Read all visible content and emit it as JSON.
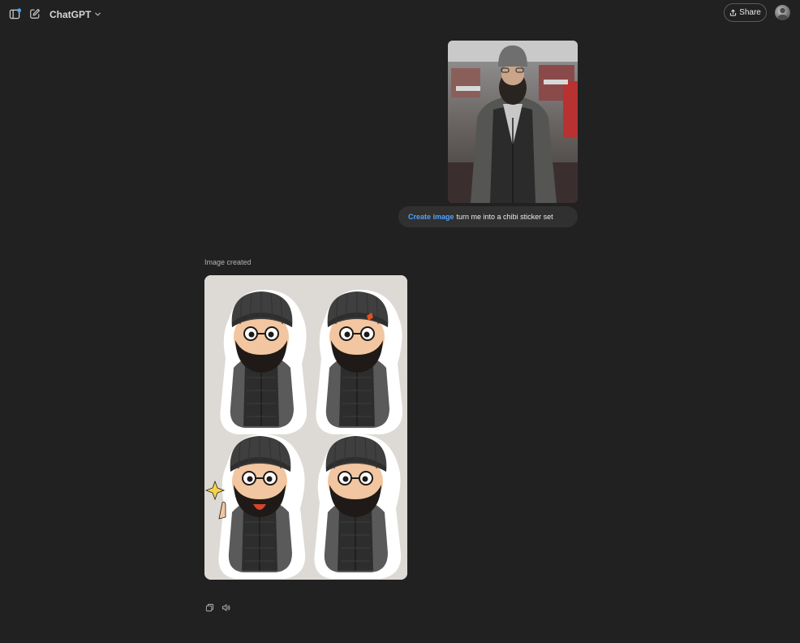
{
  "header": {
    "model_name": "ChatGPT",
    "share_label": "Share",
    "icons": [
      "sidebar-toggle-icon",
      "new-chat-icon",
      "chevron-down-icon",
      "share-upload-icon",
      "avatar"
    ]
  },
  "user_message": {
    "image_alt": "photo of man with beard wearing beanie and puffer vest",
    "tool_tag": "Create image",
    "prompt": "turn me into a chibi sticker set"
  },
  "assistant_message": {
    "status_label": "Image created",
    "image_alt": "chibi sticker set of four expressions",
    "actions": [
      "copy-icon",
      "read-aloud-icon"
    ]
  },
  "colors": {
    "background": "#212121",
    "bubble": "#303030",
    "accent": "#4ea2ff",
    "sticker_sheet": "#dddad5"
  }
}
